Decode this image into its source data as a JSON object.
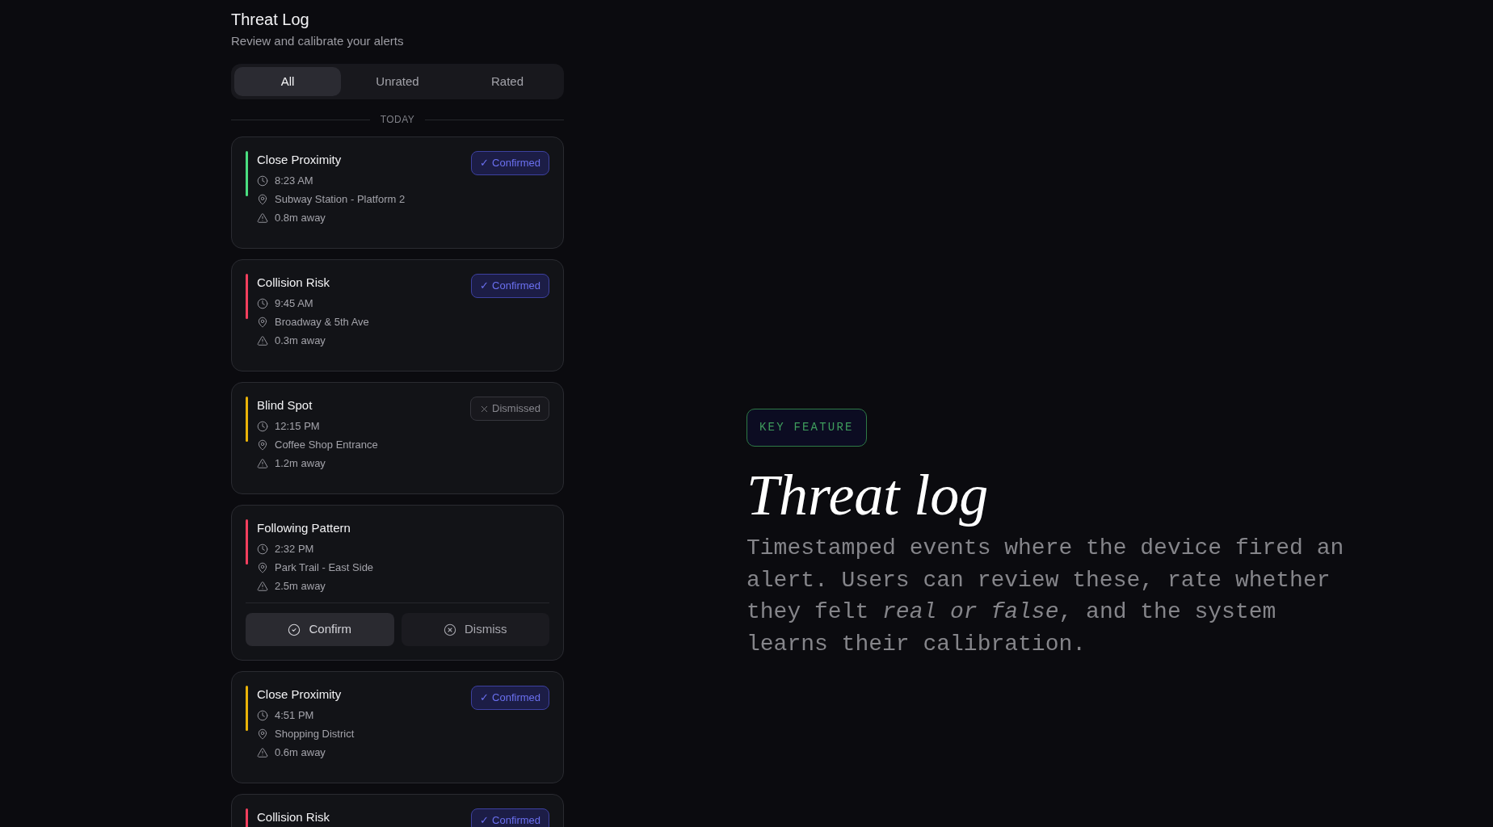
{
  "header": {
    "title": "Threat Log",
    "subtitle": "Review and calibrate your alerts"
  },
  "tabs": [
    {
      "label": "All",
      "selected": true
    },
    {
      "label": "Unrated",
      "selected": false
    },
    {
      "label": "Rated",
      "selected": false
    }
  ],
  "section_label": "TODAY",
  "alerts": [
    {
      "title": "Close Proximity",
      "color": "#4ade80",
      "time": "8:23 AM",
      "location": "Subway Station - Platform 2",
      "distance": "0.8m away",
      "badge": {
        "kind": "confirmed",
        "label": "✓ Confirmed"
      }
    },
    {
      "title": "Collision Risk",
      "color": "#f43f5e",
      "time": "9:45 AM",
      "location": "Broadway & 5th Ave",
      "distance": "0.3m away",
      "badge": {
        "kind": "confirmed",
        "label": "✓ Confirmed"
      }
    },
    {
      "title": "Blind Spot",
      "color": "#eab308",
      "time": "12:15 PM",
      "location": "Coffee Shop Entrance",
      "distance": "1.2m away",
      "badge": {
        "kind": "dismissed",
        "label": "Dismissed"
      }
    },
    {
      "title": "Following Pattern",
      "color": "#f43f5e",
      "time": "2:32 PM",
      "location": "Park Trail - East Side",
      "distance": "2.5m away",
      "actions": [
        {
          "kind": "confirm",
          "label": "Confirm"
        },
        {
          "kind": "dismiss",
          "label": "Dismiss"
        }
      ]
    },
    {
      "title": "Close Proximity",
      "color": "#eab308",
      "time": "4:51 PM",
      "location": "Shopping District",
      "distance": "0.6m away",
      "badge": {
        "kind": "confirmed",
        "label": "✓ Confirmed"
      }
    },
    {
      "title": "Collision Risk",
      "color": "#f43f5e",
      "badge": {
        "kind": "confirmed",
        "label": "✓ Confirmed"
      }
    }
  ],
  "feature": {
    "tag": "KEY FEATURE",
    "heading": "Threat log",
    "description": "Timestamped events where the device fired an alert. Users can review these, rate whether they felt *real or false*, and the system learns their calibration."
  }
}
